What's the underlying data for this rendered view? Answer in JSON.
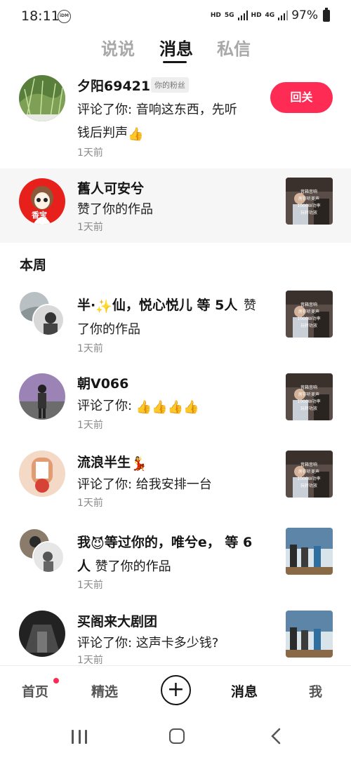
{
  "status_bar": {
    "time": "18:11",
    "idm": "iDM",
    "hd1": "HD",
    "net": "5G",
    "hd2": "HD",
    "net2": "4G",
    "battery": "97%"
  },
  "tabs": [
    {
      "label": "说说",
      "active": false
    },
    {
      "label": "消息",
      "active": true
    },
    {
      "label": "私信",
      "active": false
    }
  ],
  "notifications": [
    {
      "name": "夕阳69421",
      "badge": "你的粉丝",
      "text_line1": "评论了你: 音响这东西，先听",
      "text_line2": "钱后判声",
      "emoji": "thumbs-up",
      "time": "1天前",
      "action": "回关"
    },
    {
      "name": "舊人可安兮",
      "text": "赞了你的作品",
      "time": "1天前",
      "avatar_text": "香宝"
    }
  ],
  "section_title": "本周",
  "week_items": [
    {
      "name": "半·",
      "name_sparkle": "✨",
      "name_rest": "仙，悦心悦儿 等 5人",
      "text_suffix": "赞",
      "text_line2": "了你的作品",
      "time": "1天前"
    },
    {
      "name": "朝V066",
      "text": "评论了你:",
      "emoji_count": 4,
      "time": "1天前"
    },
    {
      "name": "流浪半生",
      "name_emoji": "💃",
      "text": "评论了你: 给我安排一台",
      "time": "1天前"
    },
    {
      "name_prefix": "我",
      "name_emoji": "😈",
      "name_rest": "等过你的，唯兮e，  等 6",
      "name_line2": "人",
      "text_suffix": "赞了你的作品",
      "time": "1天前"
    },
    {
      "name": "买阁来大剧团",
      "text": "评论了你: 这声卡多少钱?",
      "time": "1天前"
    }
  ],
  "thumb_caption": "音箱音响\n房存听美声\n1000W功率\n玩转功放",
  "bottom_nav": [
    {
      "label": "首页",
      "has_dot": true
    },
    {
      "label": "精选"
    },
    {
      "label": "+"
    },
    {
      "label": "消息",
      "active": true
    },
    {
      "label": "我"
    }
  ],
  "colors": {
    "accent": "#fe2c55",
    "text": "#161616",
    "muted": "#8a8a8a"
  }
}
